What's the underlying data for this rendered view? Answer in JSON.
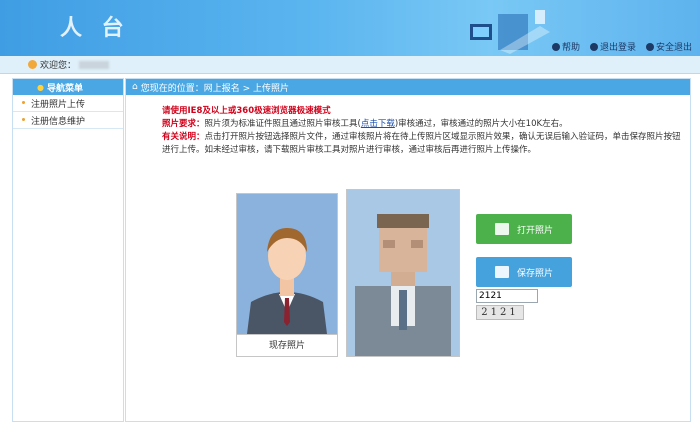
{
  "header": {
    "title": "人 台",
    "links": [
      "帮助",
      "退出登录",
      "安全退出"
    ]
  },
  "welcome": {
    "label": "欢迎您："
  },
  "sidebar": {
    "head": "导航菜单",
    "items": [
      {
        "label": "注册照片上传"
      },
      {
        "label": "注册信息维护"
      }
    ]
  },
  "breadcrumb": {
    "text": "您现在的位置：网上报名 > 上传照片"
  },
  "notice": {
    "browser": "请使用IE8及以上或360极速浏览器极速模式",
    "req_label": "照片要求：",
    "req_text_1": "照片须为标准证件照且通过照片审核工具(",
    "req_link": "点击下载",
    "req_text_2": ")审核通过，审核通过的照片大小在10K左右。",
    "note_label": "有关说明：",
    "note_text": "点击打开照片按钮选择照片文件，通过审核照片将在待上传照片区域显示照片效果，确认无误后输入验证码，单击保存照片按钮进行上传。如未经过审核，请下载照片审核工具对照片进行审核，通过审核后再进行照片上传操作。"
  },
  "photos": {
    "sample_caption": "现存照片"
  },
  "buttons": {
    "open": "打开照片",
    "save": "保存照片"
  },
  "captcha": {
    "input_value": "2121",
    "image_text": "2121"
  }
}
